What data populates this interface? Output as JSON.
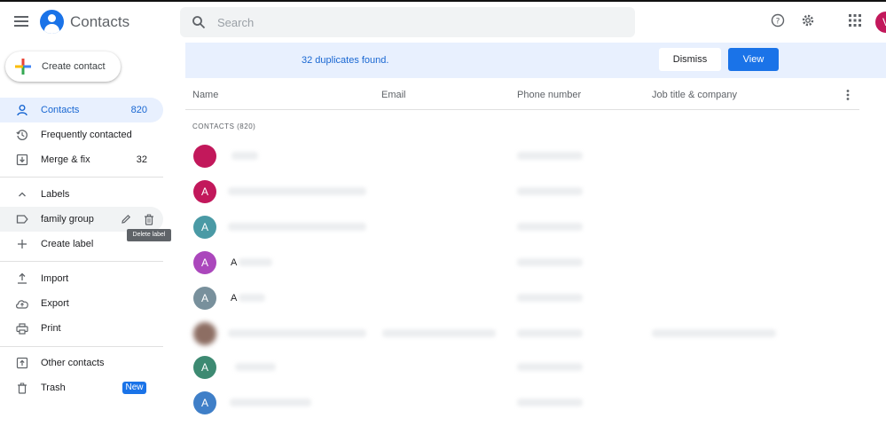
{
  "header": {
    "app_title": "Contacts",
    "search_placeholder": "Search",
    "avatar_initial": "V",
    "avatar_color": "#c2185b"
  },
  "sidebar": {
    "create_label": "Create contact",
    "items": [
      {
        "label": "Contacts",
        "count": "820",
        "icon": "person-icon",
        "active": true
      },
      {
        "label": "Frequently contacted",
        "count": "",
        "icon": "history-icon"
      },
      {
        "label": "Merge & fix",
        "count": "32",
        "icon": "merge-icon"
      }
    ],
    "labels_header": "Labels",
    "label_items": [
      {
        "label": "family group",
        "icon": "label-icon"
      }
    ],
    "create_label_text": "Create label",
    "tooltip": "Delete label",
    "utility_items": [
      {
        "label": "Import",
        "icon": "upload-icon"
      },
      {
        "label": "Export",
        "icon": "cloud-upload-icon"
      },
      {
        "label": "Print",
        "icon": "printer-icon"
      }
    ],
    "other_items": [
      {
        "label": "Other contacts",
        "icon": "other-contacts-icon"
      },
      {
        "label": "Trash",
        "icon": "trash-icon",
        "badge": "New"
      }
    ]
  },
  "banner": {
    "message": "32 duplicates found.",
    "dismiss_label": "Dismiss",
    "view_label": "View"
  },
  "table": {
    "columns": [
      "Name",
      "Email",
      "Phone number",
      "Job title & company"
    ],
    "section_label": "CONTACTS (820)",
    "rows": [
      {
        "initial": "",
        "color": "#c2185b",
        "name": ""
      },
      {
        "initial": "A",
        "color": "#c2185b",
        "name": ""
      },
      {
        "initial": "A",
        "color": "#4a9aa5",
        "name": ""
      },
      {
        "initial": "A",
        "color": "#ab47bc",
        "name": "A"
      },
      {
        "initial": "A",
        "color": "#78909c",
        "name": "A"
      },
      {
        "initial": "",
        "color": "#8d6e63",
        "name": ""
      },
      {
        "initial": "A",
        "color": "#3d8a72",
        "name": ""
      },
      {
        "initial": "A",
        "color": "#3f7fc8",
        "name": ""
      }
    ]
  },
  "colors": {
    "accent": "#1a73e8",
    "active_nav_bg": "#e8f0fe"
  }
}
